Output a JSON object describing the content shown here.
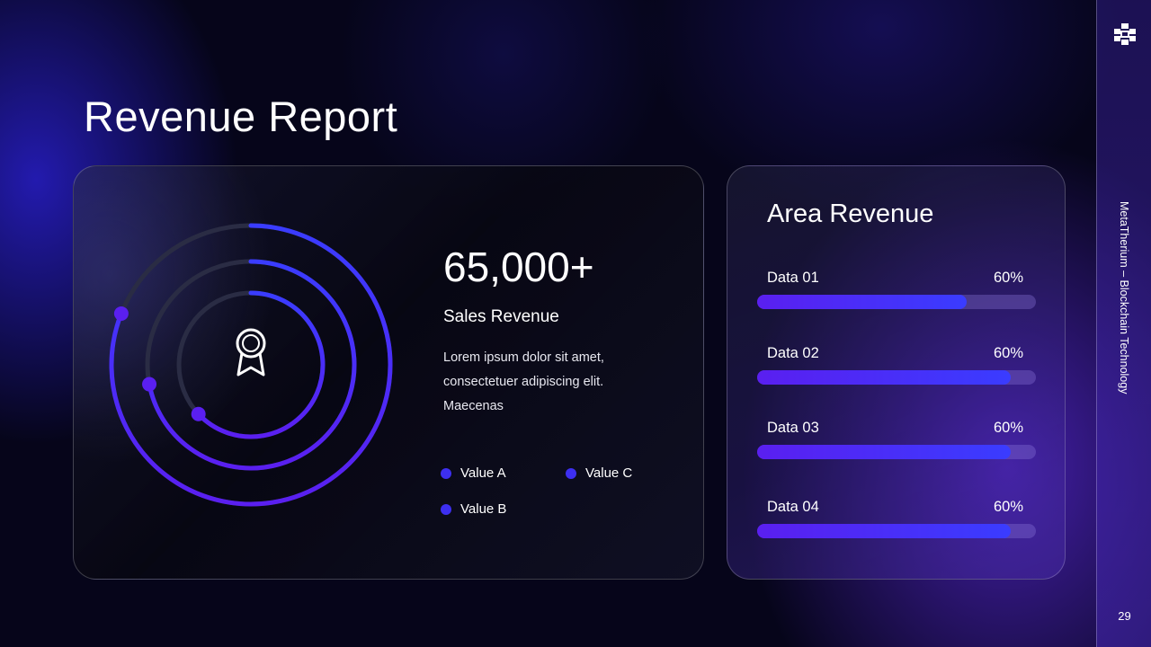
{
  "slide": {
    "title": "Revenue Report",
    "page_number": "29",
    "sidebar_text": "MetaTherium – Blockchain Technology"
  },
  "colors": {
    "accent_blue": "#3a3cff",
    "accent_purple": "#5a1ff0",
    "legend_dot": "#3d2ff0",
    "ring_track": "#2a2c44"
  },
  "icons": {
    "center": "award-badge-icon",
    "logo": "blocks-logo-icon"
  },
  "summary": {
    "big_number": "65,000+",
    "label": "Sales Revenue",
    "description": "Lorem ipsum dolor sit amet, consectetuer adipiscing elit. Maecenas",
    "legend": [
      "Value A",
      "Value B",
      "Value C"
    ]
  },
  "rings": [
    {
      "name": "Value A",
      "fraction": 0.63
    },
    {
      "name": "Value B",
      "fraction": 0.72
    },
    {
      "name": "Value C",
      "fraction": 0.81
    }
  ],
  "area_revenue": {
    "title": "Area Revenue",
    "rows": [
      {
        "label": "Data 01",
        "percent_label": "60%",
        "fill": 0.75
      },
      {
        "label": "Data 02",
        "percent_label": "60%",
        "fill": 0.91
      },
      {
        "label": "Data 03",
        "percent_label": "60%",
        "fill": 0.91
      },
      {
        "label": "Data 04",
        "percent_label": "60%",
        "fill": 0.91
      }
    ]
  }
}
